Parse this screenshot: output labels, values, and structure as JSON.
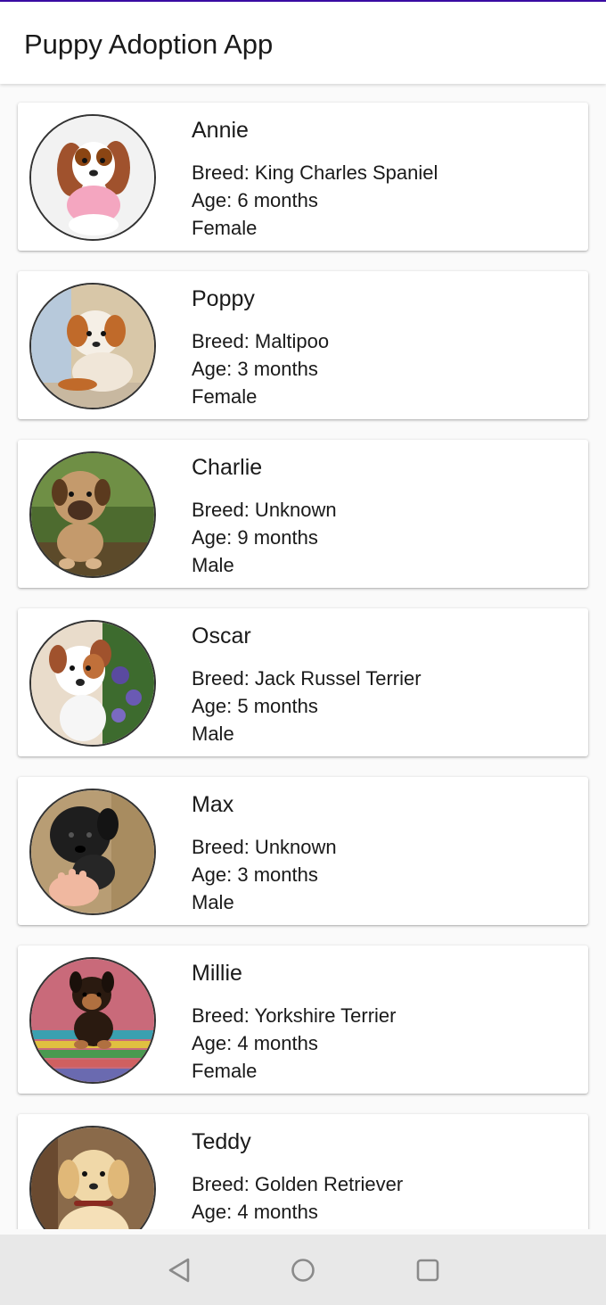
{
  "app_bar": {
    "title": "Puppy Adoption App"
  },
  "puppies": [
    {
      "name": "Annie",
      "breed": "Breed: King Charles Spaniel",
      "age": "Age: 6 months",
      "sex": "Female"
    },
    {
      "name": "Poppy",
      "breed": "Breed: Maltipoo",
      "age": "Age: 3 months",
      "sex": "Female"
    },
    {
      "name": "Charlie",
      "breed": "Breed: Unknown",
      "age": "Age: 9 months",
      "sex": "Male"
    },
    {
      "name": "Oscar",
      "breed": "Breed: Jack Russel Terrier",
      "age": "Age: 5 months",
      "sex": "Male"
    },
    {
      "name": "Max",
      "breed": "Breed: Unknown",
      "age": "Age: 3 months",
      "sex": "Male"
    },
    {
      "name": "Millie",
      "breed": "Breed: Yorkshire Terrier",
      "age": "Age: 4 months",
      "sex": "Female"
    },
    {
      "name": "Teddy",
      "breed": "Breed: Golden Retriever",
      "age": "Age: 4 months",
      "sex": ""
    }
  ],
  "nav_bar": {
    "back_icon": "back-triangle-icon",
    "home_icon": "home-circle-icon",
    "recents_icon": "recents-square-icon"
  },
  "colors": {
    "accent": "#3a0ca3",
    "nav_icon": "#8a8a8a"
  }
}
